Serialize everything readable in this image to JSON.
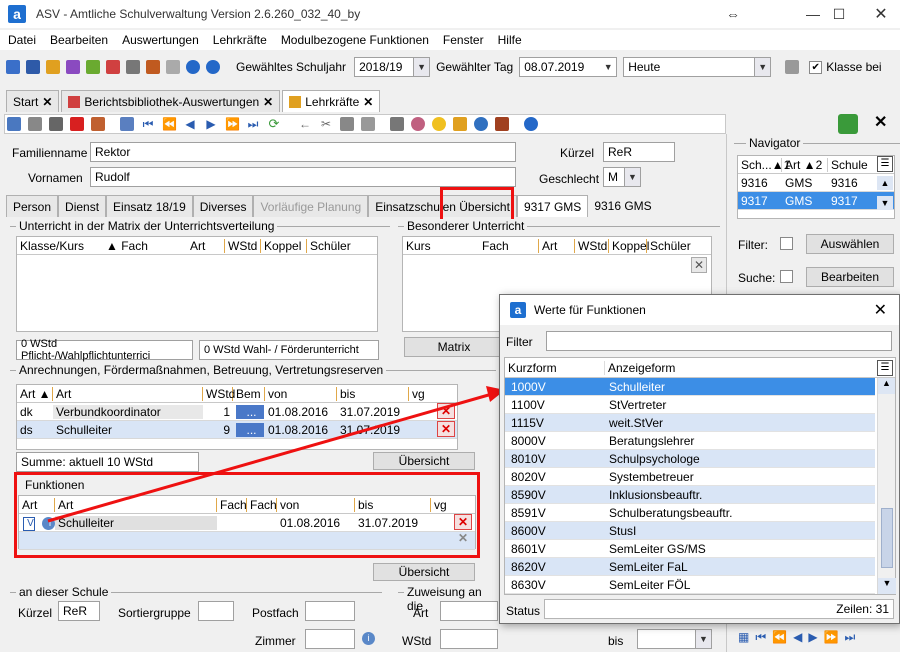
{
  "window": {
    "title": "ASV - Amtliche Schulverwaltung Version 2.6.260_032_40_by",
    "app_logo_letter": "a"
  },
  "menu": [
    "Datei",
    "Bearbeiten",
    "Auswertungen",
    "Lehrkräfte",
    "Modulbezogene Funktionen",
    "Fenster",
    "Hilfe"
  ],
  "toolbar": {
    "schuljahr_label": "Gewähltes Schuljahr",
    "schuljahr_value": "2018/19",
    "tag_label": "Gewählter Tag",
    "tag_value": "08.07.2019",
    "heute_value": "Heute",
    "klasse_label": "Klasse bei"
  },
  "doc_tabs": [
    {
      "label": "Start"
    },
    {
      "label": "Berichtsbibliothek-Auswertungen"
    },
    {
      "label": "Lehrkräfte"
    }
  ],
  "person": {
    "familienname_label": "Familienname",
    "familienname": "Rektor",
    "vorname_label": "Vornamen",
    "vorname": "Rudolf",
    "kuerzel_label": "Kürzel",
    "kuerzel": "ReR",
    "geschlecht_label": "Geschlecht",
    "geschlecht": "M"
  },
  "sub_tabs": [
    "Person",
    "Dienst",
    "Einsatz 18/19",
    "Diverses",
    "Vorläufige Planung",
    "Einsatzschulen Übersicht",
    "9317 GMS",
    "9316 GMS"
  ],
  "unterricht": {
    "title": "Unterricht in der Matrix der Unterrichtsverteilung",
    "columns": [
      "Klasse/Kurs",
      "Fach",
      "Art",
      "WStd",
      "Koppel",
      "Schüler"
    ],
    "sum1": "0 WStd Pflicht-/Wahlpflichtunterrici",
    "sum2": "0 WStd Wahl- / Förderunterricht"
  },
  "besonderer": {
    "title": "Besonderer Unterricht",
    "columns": [
      "Kurs",
      "Fach",
      "Art",
      "WStd",
      "Koppel",
      "Schüler"
    ],
    "matrix_button": "Matrix"
  },
  "anrechnungen": {
    "title": "Anrechnungen, Fördermaßnahmen, Betreuung, Vertretungsreserven",
    "columns": [
      "Art",
      "Art",
      "WStd",
      "Bem",
      "von",
      "bis",
      "vg"
    ],
    "rows": [
      {
        "art": "dk",
        "name": "Verbundkoordinator",
        "wstd": "1",
        "von": "01.08.2016",
        "bis": "31.07.2019"
      },
      {
        "art": "ds",
        "name": "Schulleiter",
        "wstd": "9",
        "von": "01.08.2016",
        "bis": "31.07.2019"
      }
    ],
    "bem_button": "...",
    "summe": "Summe: aktuell 10 WStd",
    "uebersicht": "Übersicht"
  },
  "funktionen": {
    "title": "Funktionen",
    "columns": [
      "Art",
      "Art",
      "Fach",
      "Fach",
      "von",
      "bis",
      "vg"
    ],
    "row": {
      "art": "V",
      "name": "Schulleiter",
      "von": "01.08.2016",
      "bis": "31.07.2019"
    },
    "uebersicht": "Übersicht"
  },
  "schule": {
    "title": "an dieser Schule",
    "kuerzel_label": "Kürzel",
    "kuerzel": "ReR",
    "sortiergruppe_label": "Sortiergruppe",
    "postfach_label": "Postfach",
    "zimmer_label": "Zimmer"
  },
  "zuweisung": {
    "title": "Zuweisung an die",
    "art_label": "Art",
    "wstd_label": "WStd",
    "bis_label": "bis"
  },
  "navigator": {
    "title": "Navigator",
    "columns": [
      "Sch...",
      "1",
      "Art",
      "2",
      "Schule"
    ],
    "rows": [
      {
        "sch": "9316",
        "art": "GMS",
        "schule": "9316"
      },
      {
        "sch": "9317",
        "art": "GMS",
        "schule": "9317"
      }
    ],
    "filter_label": "Filter:",
    "auswaehlen": "Auswählen",
    "suche_label": "Suche:",
    "bearbeiten": "Bearbeiten"
  },
  "dialog": {
    "title": "Werte für Funktionen",
    "filter_label": "Filter",
    "col1": "Kurzform",
    "col2": "Anzeigeform",
    "rows": [
      {
        "k": "1000V",
        "a": "Schulleiter"
      },
      {
        "k": "1100V",
        "a": "StVertreter"
      },
      {
        "k": "1115V",
        "a": "weit.StVer"
      },
      {
        "k": "8000V",
        "a": "Beratungslehrer"
      },
      {
        "k": "8010V",
        "a": "Schulpsychologe"
      },
      {
        "k": "8020V",
        "a": "Systembetreuer"
      },
      {
        "k": "8590V",
        "a": "Inklusionsbeauftr."
      },
      {
        "k": "8591V",
        "a": "Schulberatungsbeauftr."
      },
      {
        "k": "8600V",
        "a": "StusI"
      },
      {
        "k": "8601V",
        "a": "SemLeiter GS/MS"
      },
      {
        "k": "8620V",
        "a": "SemLeiter FaL"
      },
      {
        "k": "8630V",
        "a": "SemLeiter FÖL"
      }
    ],
    "status_label": "Status",
    "zeilen": "Zeilen: 31"
  },
  "colors": {
    "accent": "#3c8ee6",
    "highlight_red": "#e11111",
    "row_alt": "#d9e5f6"
  }
}
